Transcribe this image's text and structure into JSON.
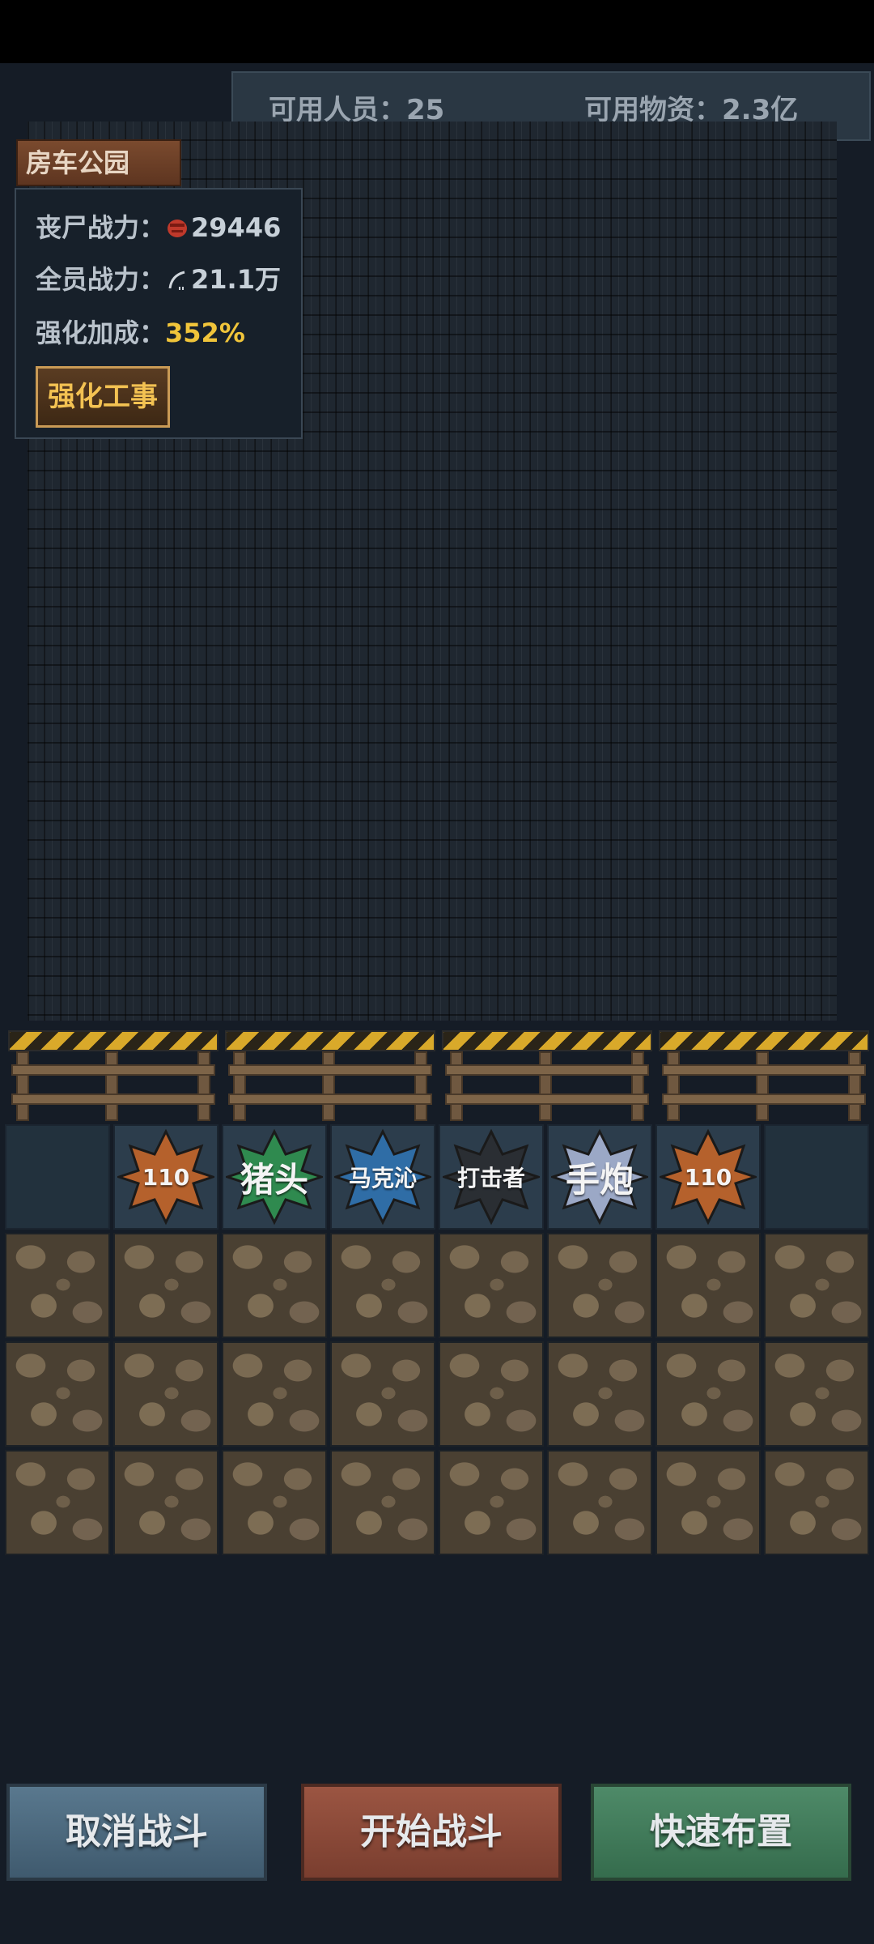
{
  "header": {
    "personnel_label": "可用人员：25",
    "supplies_label": "可用物资：2.3亿"
  },
  "location": {
    "name": "房车公园"
  },
  "info": {
    "zombie_power_label": "丧尸战力：",
    "zombie_power_value": "29446",
    "team_power_label": "全员战力：",
    "team_power_value": "21.1万",
    "bonus_label": "强化加成：",
    "bonus_value": "352%",
    "reinforce_button": "强化工事"
  },
  "deploy_slots": [
    {
      "label": "",
      "color": ""
    },
    {
      "label": "110",
      "color": "#b5612c"
    },
    {
      "label": "猪头",
      "color": "#2f8a4f"
    },
    {
      "label": "马克沁",
      "color": "#2f6da6"
    },
    {
      "label": "打击者",
      "color": "#2a2e33"
    },
    {
      "label": "手炮",
      "color": "#9ba8c6"
    },
    {
      "label": "110",
      "color": "#b5612c"
    },
    {
      "label": "",
      "color": ""
    }
  ],
  "buttons": {
    "cancel": "取消战斗",
    "start": "开始战斗",
    "quick": "快速布置"
  }
}
